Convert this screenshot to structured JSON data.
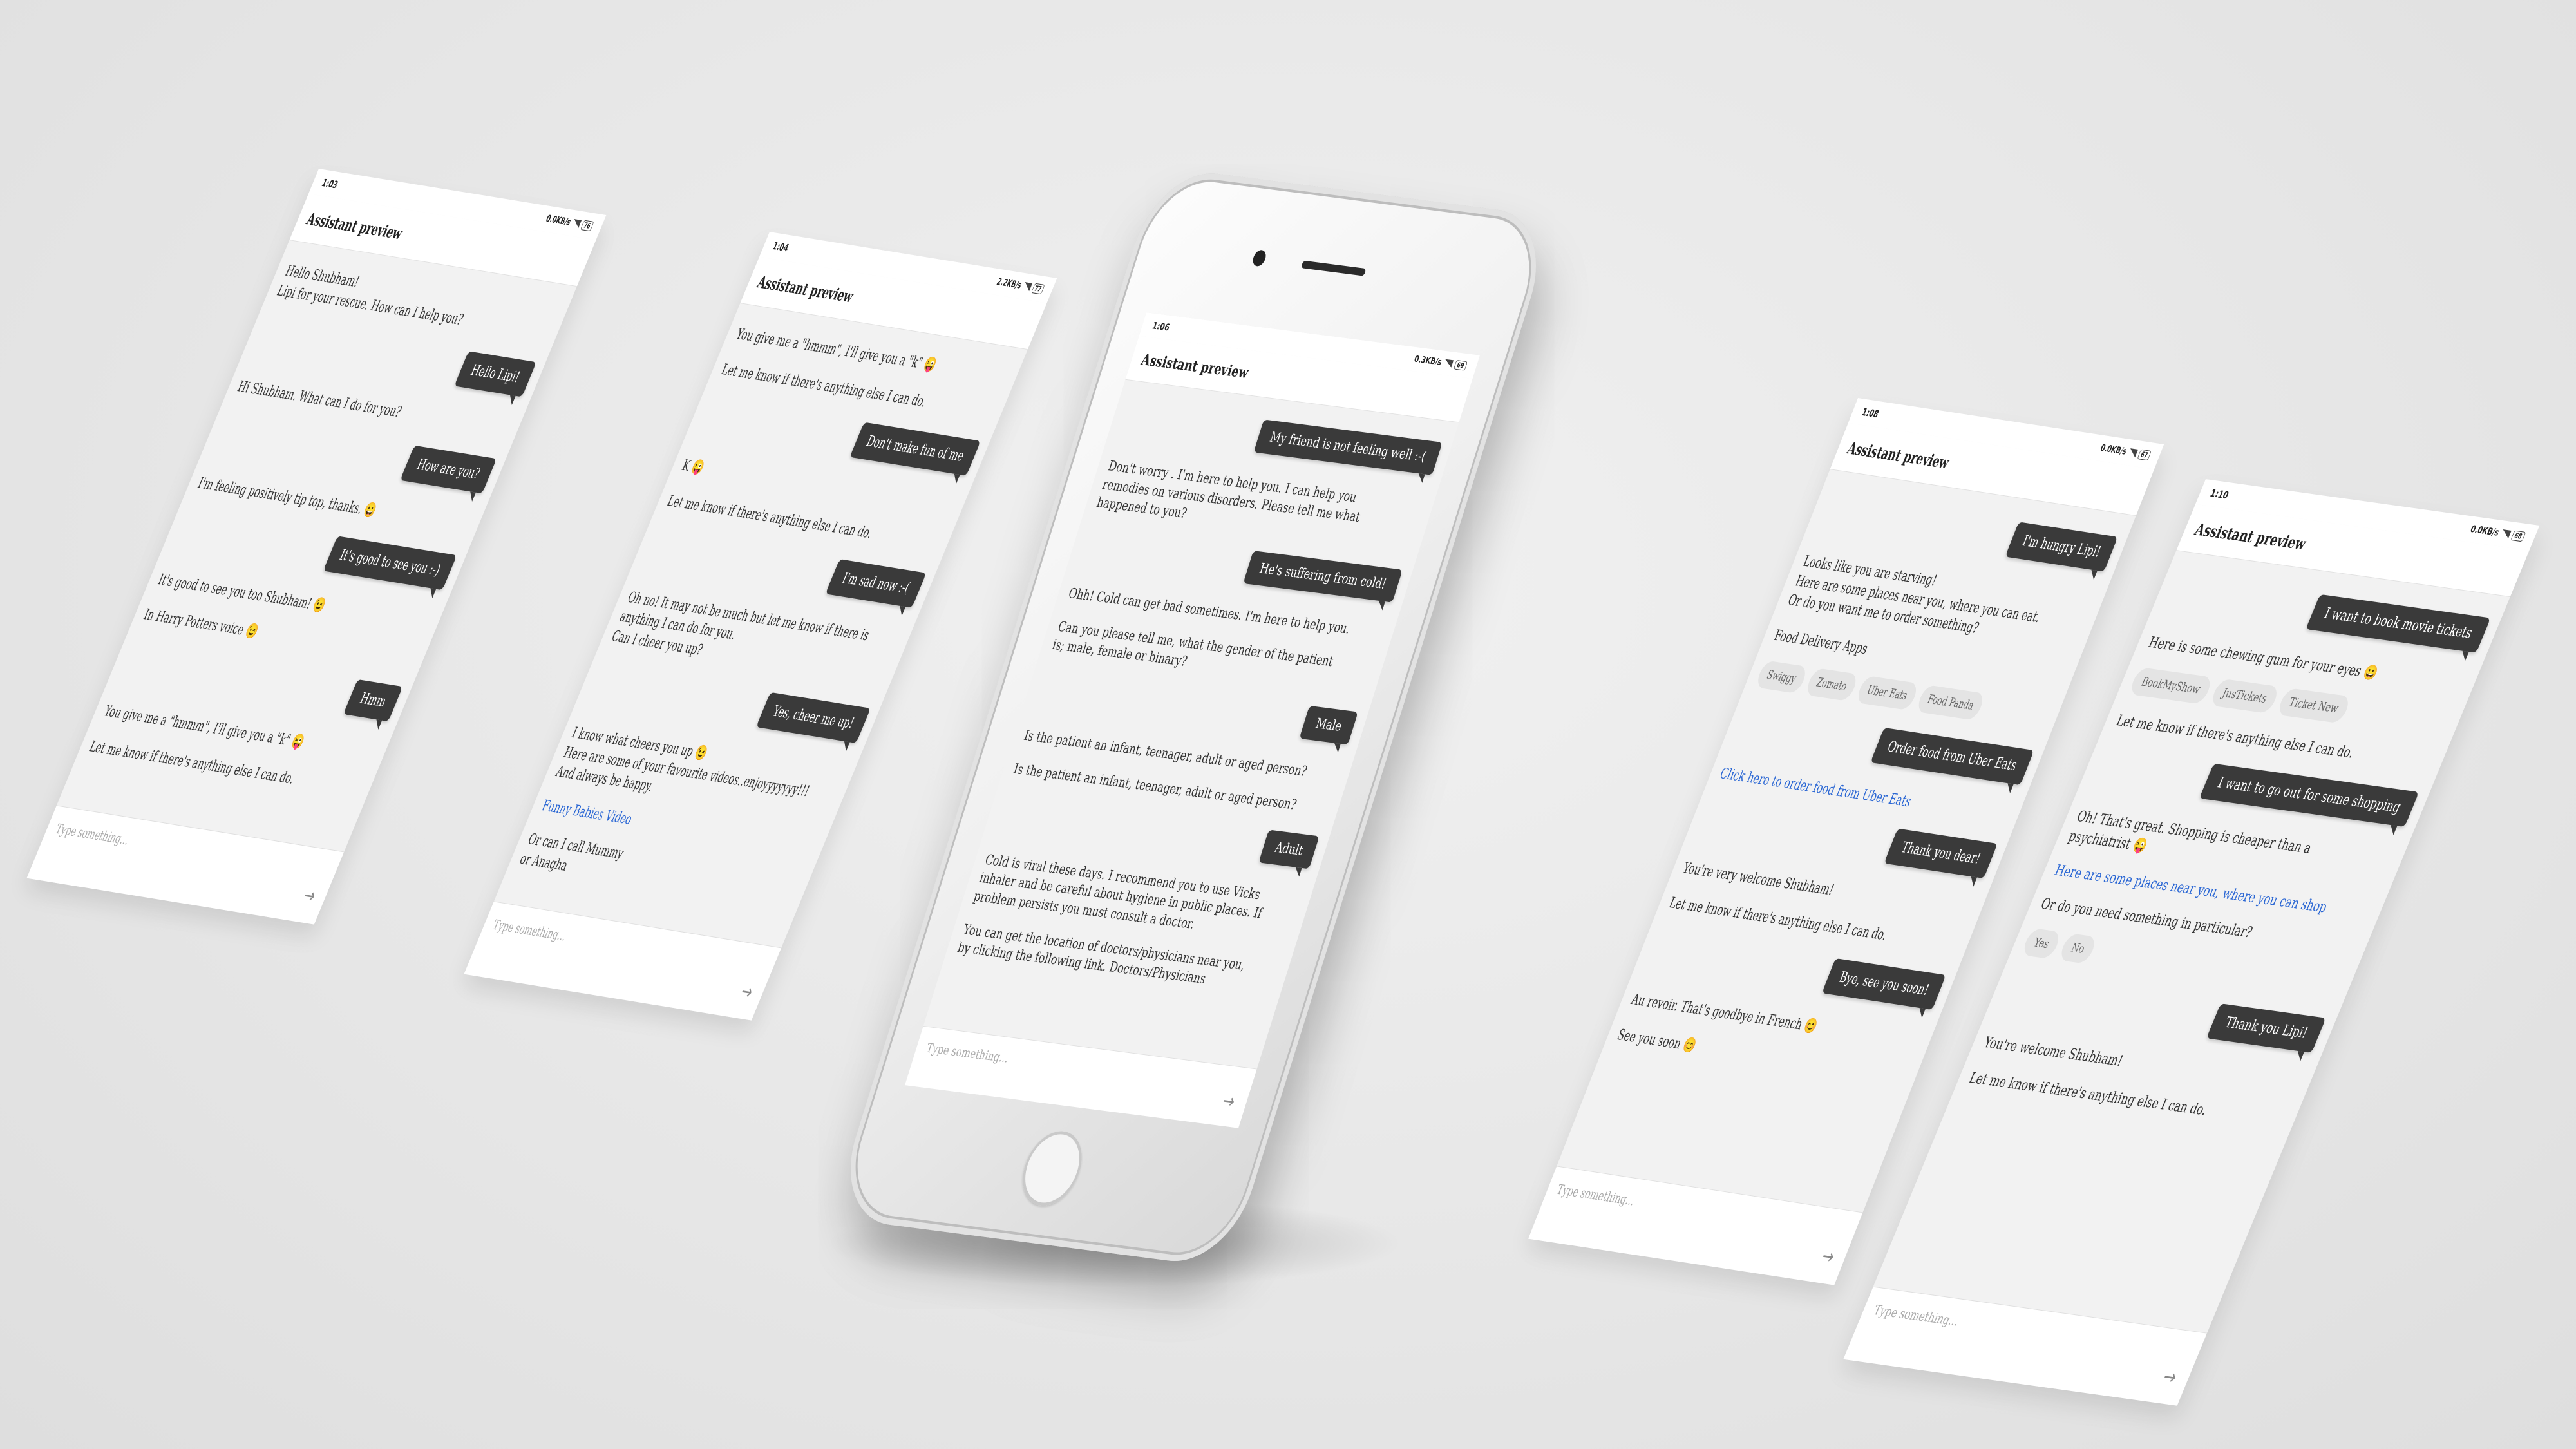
{
  "app": {
    "header_title": "Assistant preview",
    "input_placeholder": "Type something..."
  },
  "screen1": {
    "time": "1:03",
    "speed": "0.0KB/s",
    "battery": "76",
    "messages": [
      {
        "type": "bot",
        "text": "Hello Shubham!\nLipi for your rescue. How can I help you?"
      },
      {
        "type": "user",
        "text": "Hello Lipi!"
      },
      {
        "type": "bot",
        "text": "Hi Shubham. What can I do for you?"
      },
      {
        "type": "user",
        "text": "How are you?"
      },
      {
        "type": "bot",
        "text": "I'm feeling positively tip top, thanks. 😀"
      },
      {
        "type": "user",
        "text": "It's good to see you :-)"
      },
      {
        "type": "bot",
        "text": "It's good to see you too Shubham! 😉"
      },
      {
        "type": "bot",
        "text": "In Harry Potters voice 😉"
      },
      {
        "type": "user",
        "text": "Hmm"
      },
      {
        "type": "bot",
        "text": "You give me a \"hmmm\", I'll give you a \"k\" 😜"
      },
      {
        "type": "bot",
        "text": "Let me know if there's anything else I can do."
      }
    ]
  },
  "screen2": {
    "time": "1:04",
    "speed": "2.2KB/s",
    "battery": "77",
    "messages": [
      {
        "type": "bot",
        "text": "You give me a \"hmmm\", I'll give you a \"k\" 😜"
      },
      {
        "type": "bot",
        "text": "Let me know if there's anything else I can do."
      },
      {
        "type": "user",
        "text": "Don't make fun of me"
      },
      {
        "type": "bot",
        "text": "K 😜"
      },
      {
        "type": "bot",
        "text": "Let me know if there's anything else I can do."
      },
      {
        "type": "user",
        "text": "I'm sad now :-("
      },
      {
        "type": "bot",
        "text": "Oh no! It may not be much but let me know if there is anything I can do for you.\nCan I cheer you up?"
      },
      {
        "type": "user",
        "text": "Yes, cheer me up!"
      },
      {
        "type": "bot",
        "text": "I know what cheers you up 😉\nHere are some of your favourite videos..enjoyyyyyyy!!!\nAnd always be happy."
      },
      {
        "type": "link",
        "text": "Funny Babies Video"
      },
      {
        "type": "bot",
        "text": "Or can I call Mummy\nor Anagha"
      }
    ]
  },
  "screen3": {
    "time": "1:06",
    "speed": "0.3KB/s",
    "battery": "69",
    "messages": [
      {
        "type": "user",
        "text": "My friend is not feeling well :-("
      },
      {
        "type": "bot",
        "text": "Don't worry . I'm here to help you. I can help you remedies on various disorders. Please tell me what happened to you?"
      },
      {
        "type": "user",
        "text": "He's suffering from cold!"
      },
      {
        "type": "bot",
        "text": "Ohh! Cold can get bad sometimes. I'm here to help you."
      },
      {
        "type": "bot",
        "text": "Can you please tell me, what the gender of the patient is; male, female or binary?"
      },
      {
        "type": "user",
        "text": "Male"
      },
      {
        "type": "bot",
        "text": "Is the patient an infant, teenager, adult or aged person?"
      },
      {
        "type": "bot",
        "text": "Is the patient an infant, teenager, adult or aged person?"
      },
      {
        "type": "user",
        "text": "Adult"
      },
      {
        "type": "bot",
        "text": "Cold is viral these days. I recommend you to use Vicks inhaler and be careful about hygiene in public places. If problem persists you must consult a doctor."
      },
      {
        "type": "bot",
        "text": "You can get the location of doctors/physicians near you, by clicking the following link. Doctors/Physicians"
      }
    ]
  },
  "screen4": {
    "time": "1:08",
    "speed": "0.0KB/s",
    "battery": "67",
    "messages": [
      {
        "type": "user",
        "text": "I'm hungry Lipi!"
      },
      {
        "type": "bot",
        "text": "Looks like you are starving!\nHere are some places near you, where you can eat.\nOr do you want me to order something?"
      },
      {
        "type": "bot",
        "text": "Food Delivery Apps"
      },
      {
        "type": "chips",
        "items": [
          "Swiggy",
          "Zomato",
          "Uber Eats",
          "Food Panda"
        ]
      },
      {
        "type": "user",
        "text": "Order food from Uber Eats"
      },
      {
        "type": "link",
        "text": "Click here to order food from Uber Eats"
      },
      {
        "type": "user",
        "text": "Thank you dear!"
      },
      {
        "type": "bot",
        "text": "You're very welcome Shubham!"
      },
      {
        "type": "bot",
        "text": "Let me know if there's anything else I can do."
      },
      {
        "type": "user",
        "text": "Bye, see you soon!"
      },
      {
        "type": "bot",
        "text": "Au revoir. That's goodbye in French 😊"
      },
      {
        "type": "bot",
        "text": "See you soon 😊"
      }
    ]
  },
  "screen5": {
    "time": "1:10",
    "speed": "0.0KB/s",
    "battery": "68",
    "messages": [
      {
        "type": "user",
        "text": "I want to book movie tickets"
      },
      {
        "type": "bot",
        "text": "Here is some chewing gum for your eyes 😀"
      },
      {
        "type": "chips",
        "items": [
          "BookMyShow",
          "JusTickets",
          "Ticket New"
        ]
      },
      {
        "type": "bot",
        "text": "Let me know if there's anything else I can do."
      },
      {
        "type": "user",
        "text": "I want to go out for some shopping"
      },
      {
        "type": "bot",
        "text": "Oh! That's great. Shopping is cheaper than a psychiatrist 😜"
      },
      {
        "type": "link",
        "text": "Here are some places near you, where you can shop"
      },
      {
        "type": "bot",
        "text": "Or do you need something in particular?"
      },
      {
        "type": "chips",
        "items": [
          "Yes",
          "No"
        ]
      },
      {
        "type": "user",
        "text": "Thank you Lipi!"
      },
      {
        "type": "bot",
        "text": "You're welcome Shubham!"
      },
      {
        "type": "bot",
        "text": "Let me know if there's anything else I can do."
      }
    ]
  }
}
